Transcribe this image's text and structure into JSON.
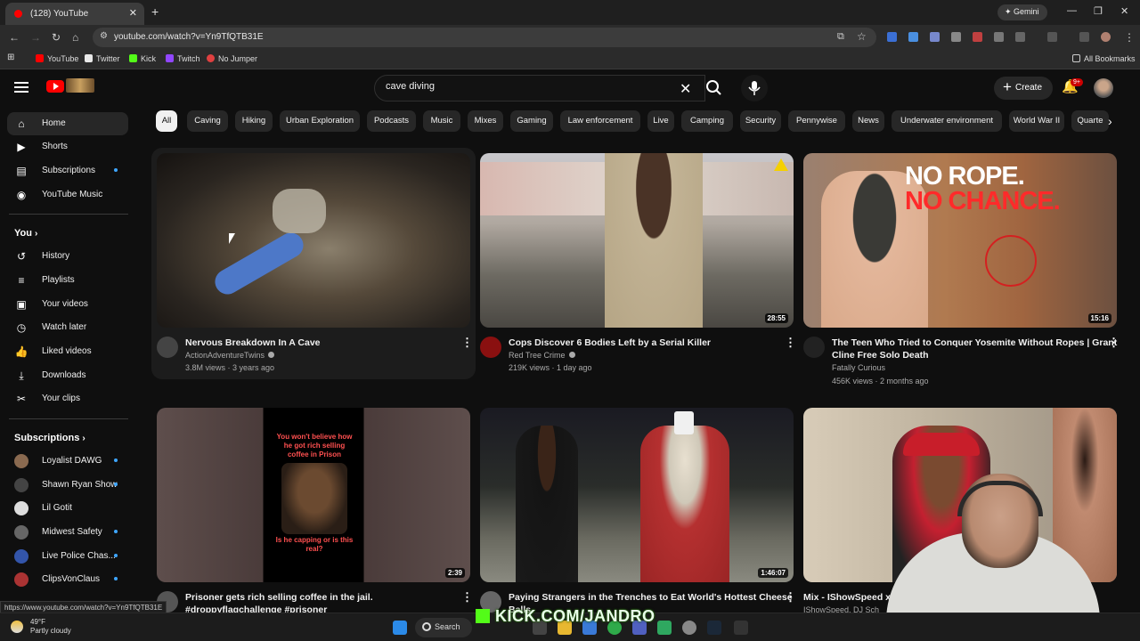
{
  "browser": {
    "tab_title": "(128) YouTube",
    "new_tab": "+",
    "gemini_label": "Gemini",
    "url": "youtube.com/watch?v=Yn9TfQTB31E",
    "bookmarks": [
      {
        "label": "YouTube",
        "color": "#ff0000"
      },
      {
        "label": "Twitter",
        "color": "#e8e8e8"
      },
      {
        "label": "Kick",
        "color": "#53fc18"
      },
      {
        "label": "Twitch",
        "color": "#9146ff"
      },
      {
        "label": "No Jumper",
        "color": "#e04040"
      }
    ],
    "all_bookmarks": "All Bookmarks",
    "status_url": "https://www.youtube.com/watch?v=Yn9TfQTB31E"
  },
  "header": {
    "search_value": "cave diving",
    "create_label": "Create",
    "notif_badge": "9+"
  },
  "sidebar": {
    "main": [
      {
        "label": "Home",
        "icon": "home-icon"
      },
      {
        "label": "Shorts",
        "icon": "shorts-icon"
      },
      {
        "label": "Subscriptions",
        "icon": "subscriptions-icon",
        "dot": true
      },
      {
        "label": "YouTube Music",
        "icon": "music-icon"
      }
    ],
    "you_header": "You",
    "you": [
      {
        "label": "History",
        "icon": "history-icon"
      },
      {
        "label": "Playlists",
        "icon": "playlists-icon"
      },
      {
        "label": "Your videos",
        "icon": "your-videos-icon"
      },
      {
        "label": "Watch later",
        "icon": "watch-later-icon"
      },
      {
        "label": "Liked videos",
        "icon": "like-icon"
      },
      {
        "label": "Downloads",
        "icon": "download-icon"
      },
      {
        "label": "Your clips",
        "icon": "scissors-icon"
      }
    ],
    "subs_header": "Subscriptions",
    "subs": [
      {
        "label": "Loyalist DAWG",
        "color": "#8a6a50"
      },
      {
        "label": "Shawn Ryan Show",
        "color": "#444444"
      },
      {
        "label": "Lil Gotit",
        "color": "#dddddd"
      },
      {
        "label": "Midwest Safety",
        "color": "#666666"
      },
      {
        "label": "Live Police Chas...",
        "color": "#3355aa"
      },
      {
        "label": "ClipsVonClaus",
        "color": "#aa3333"
      }
    ]
  },
  "chips": [
    "All",
    "Caving",
    "Hiking",
    "Urban Exploration",
    "Podcasts",
    "Music",
    "Mixes",
    "Gaming",
    "Law enforcement",
    "Live",
    "Camping",
    "Security",
    "Pennywise",
    "News",
    "Underwater environment",
    "World War II",
    "Quarte"
  ],
  "videos": [
    {
      "title": "Nervous Breakdown In A Cave",
      "title2": "",
      "channel": "ActionAdventureTwins",
      "meta": "3.8M views · 3 years ago",
      "duration": ""
    },
    {
      "title": "Cops Discover 6 Bodies Left by a Serial Killer",
      "title2": "",
      "channel": "Red Tree Crime",
      "meta": "219K views · 1 day ago",
      "duration": "28:55"
    },
    {
      "title": "The Teen Who Tried to Conquer Yosemite Without Ropes | Grant",
      "title2": "Cline Free Solo Death",
      "channel": "Fatally Curious",
      "meta": "456K views · 2 months ago",
      "duration": "15:16",
      "thumb_text1": "NO ROPE.",
      "thumb_text2": "NO CHANCE."
    },
    {
      "title": "Prisoner gets rich selling coffee in the jail.",
      "title2": "#droppyflagchallenge #prisoner",
      "channel": "",
      "meta": "",
      "duration": "2:39",
      "thumb_text1": "You won't believe how he got rich selling coffee in Prison",
      "thumb_text2": "Is he capping or is this real?"
    },
    {
      "title": "Paying Strangers in the Trenches to Eat World's Hottest Cheese",
      "title2": "Balls",
      "channel": "",
      "meta": "",
      "duration": "1:46:07"
    },
    {
      "title": "Mix - IShowSpeed x M",
      "title2": "IShowSpeed, DJ Sch",
      "channel": "",
      "meta": "",
      "duration": ""
    }
  ],
  "taskbar": {
    "weather_temp": "49°F",
    "weather_desc": "Partly cloudy",
    "search_label": "Search",
    "overlay_text": "KICK.COM/JANDRO"
  }
}
